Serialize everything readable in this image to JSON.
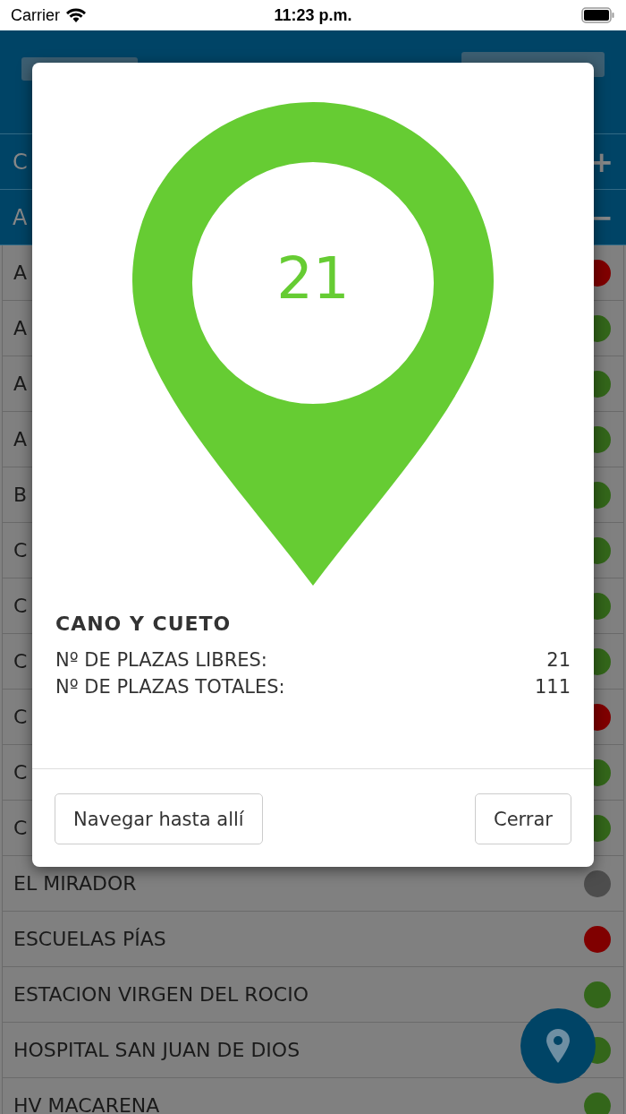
{
  "status_bar": {
    "carrier": "Carrier",
    "time": "11:23 p.m."
  },
  "sections": [
    {
      "label": "C",
      "action": "+"
    },
    {
      "label": "A",
      "action": "−"
    }
  ],
  "parkings": [
    {
      "name": "A",
      "color": "#800000"
    },
    {
      "name": "A",
      "color": "#33661a"
    },
    {
      "name": "A",
      "color": "#33661a"
    },
    {
      "name": "A",
      "color": "#33661a"
    },
    {
      "name": "B",
      "color": "#33661a"
    },
    {
      "name": "C",
      "color": "#33661a"
    },
    {
      "name": "C",
      "color": "#33661a"
    },
    {
      "name": "C",
      "color": "#33661a"
    },
    {
      "name": "C",
      "color": "#800000"
    },
    {
      "name": "C",
      "color": "#33661a"
    },
    {
      "name": "C",
      "color": "#33661a"
    },
    {
      "name": "EL MIRADOR",
      "color": "#4d4d4d"
    },
    {
      "name": "ESCUELAS PÍAS",
      "color": "#800000"
    },
    {
      "name": "ESTACION VIRGEN DEL ROCIO",
      "color": "#33661a"
    },
    {
      "name": "HOSPITAL SAN JUAN DE DIOS",
      "color": "#33661a"
    },
    {
      "name": "HV MACARENA",
      "color": "#33661a"
    }
  ],
  "dialog": {
    "free_count": "21",
    "title": "CANO Y CUETO",
    "stats": [
      {
        "label": "Nº DE PLAZAS LIBRES:",
        "value": "21"
      },
      {
        "label": "Nº DE PLAZAS TOTALES:",
        "value": "111"
      }
    ],
    "buttons": [
      {
        "label": "Navegar hasta allí"
      },
      {
        "label": "Cerrar"
      }
    ]
  }
}
